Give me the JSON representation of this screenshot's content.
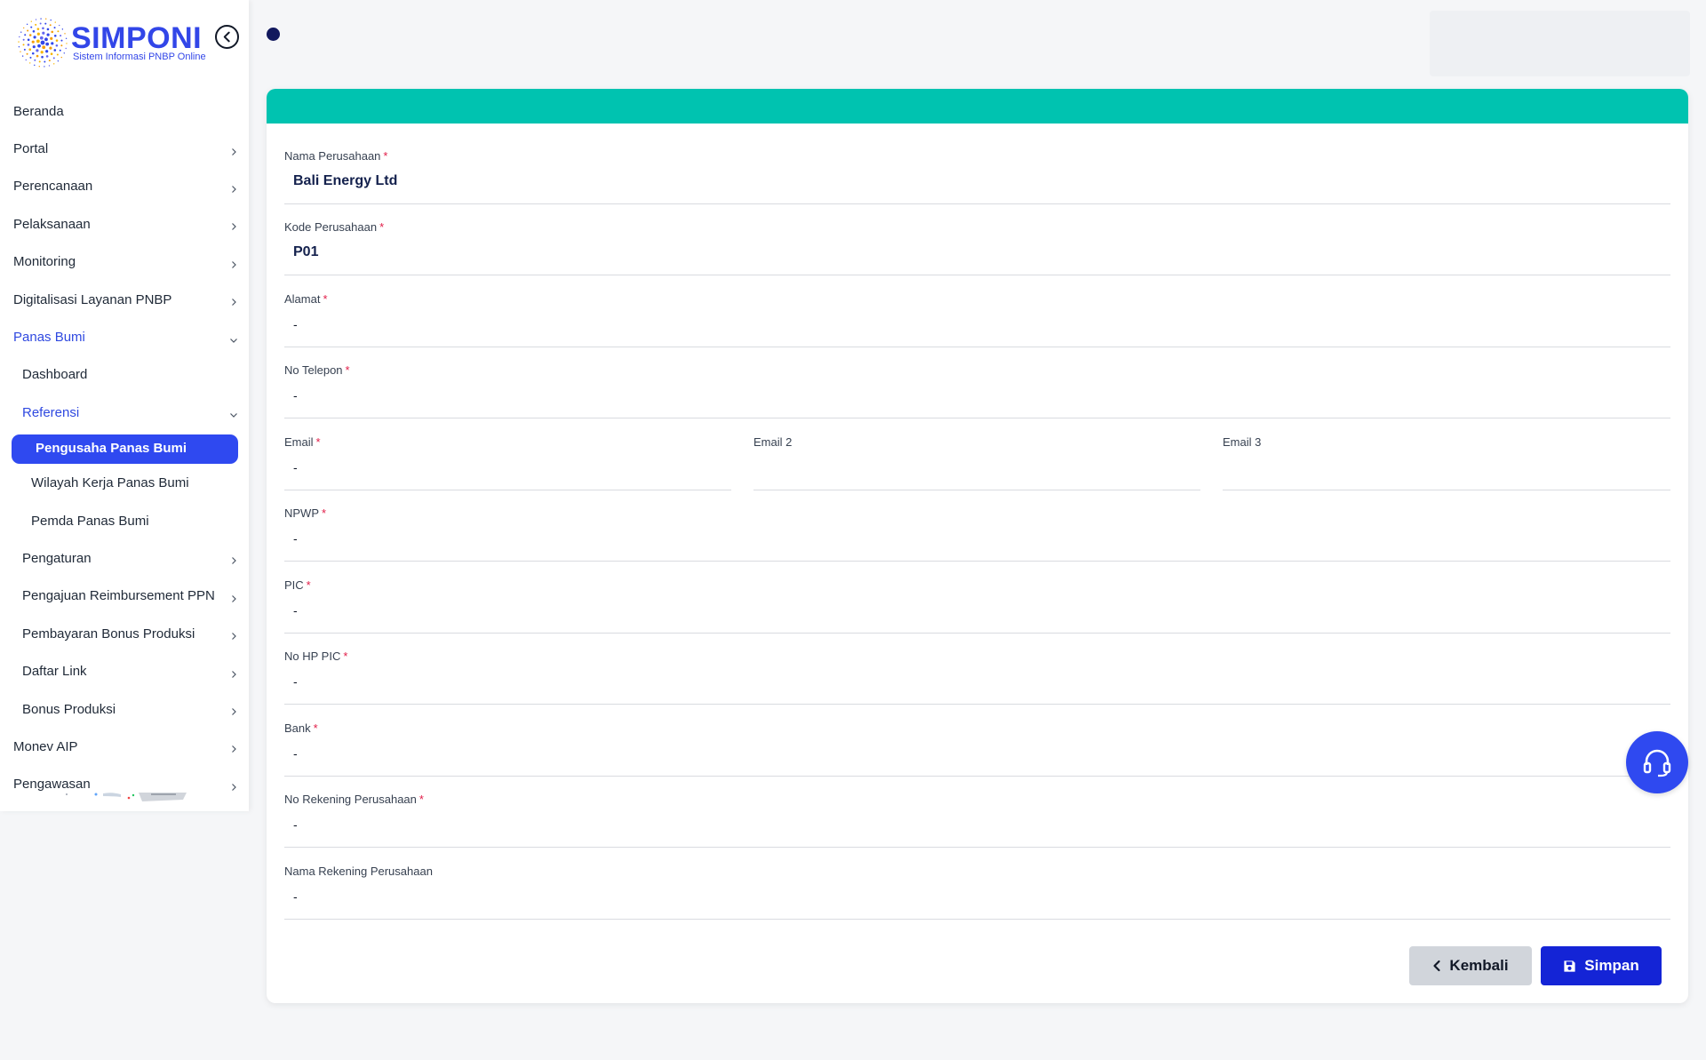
{
  "brand": {
    "title": "SIMPONI",
    "subtitle": "Sistem Informasi PNBP Online"
  },
  "sidebar": {
    "items": [
      {
        "label": "Beranda",
        "has_chevron": false,
        "state": "normal"
      },
      {
        "label": "Portal",
        "has_chevron": true,
        "chevron": "right",
        "state": "normal"
      },
      {
        "label": "Perencanaan",
        "has_chevron": true,
        "chevron": "right",
        "state": "normal"
      },
      {
        "label": "Pelaksanaan",
        "has_chevron": true,
        "chevron": "right",
        "state": "normal"
      },
      {
        "label": "Monitoring",
        "has_chevron": true,
        "chevron": "right",
        "state": "normal"
      },
      {
        "label": "Digitalisasi Layanan PNBP",
        "has_chevron": true,
        "chevron": "right",
        "state": "normal"
      },
      {
        "label": "Panas Bumi",
        "has_chevron": true,
        "chevron": "down",
        "state": "expanded"
      },
      {
        "label": "Dashboard",
        "has_chevron": false,
        "state": "normal"
      },
      {
        "label": "Referensi",
        "has_chevron": true,
        "chevron": "down",
        "state": "expanded"
      },
      {
        "label": "Pengusaha Panas Bumi",
        "has_chevron": false,
        "state": "active"
      },
      {
        "label": "Wilayah Kerja Panas Bumi",
        "has_chevron": false,
        "state": "normal"
      },
      {
        "label": "Pemda Panas Bumi",
        "has_chevron": false,
        "state": "normal"
      },
      {
        "label": "Pengaturan",
        "has_chevron": true,
        "chevron": "right",
        "state": "normal"
      },
      {
        "label": "Pengajuan Reimbursement PPN",
        "has_chevron": true,
        "chevron": "right",
        "state": "normal"
      },
      {
        "label": "Pembayaran Bonus Produksi",
        "has_chevron": true,
        "chevron": "right",
        "state": "normal"
      },
      {
        "label": "Daftar Link",
        "has_chevron": true,
        "chevron": "right",
        "state": "normal"
      },
      {
        "label": "Bonus Produksi",
        "has_chevron": true,
        "chevron": "right",
        "state": "normal"
      },
      {
        "label": "Monev AIP",
        "has_chevron": true,
        "chevron": "right",
        "state": "normal"
      },
      {
        "label": "Pengawasan",
        "has_chevron": true,
        "chevron": "right",
        "state": "normal"
      }
    ]
  },
  "form": {
    "header_color": "#00c3b0",
    "fields": {
      "nama_perusahaan": {
        "label": "Nama Perusahaan",
        "required": "*",
        "value": "Bali Energy Ltd"
      },
      "kode_perusahaan": {
        "label": "Kode Perusahaan",
        "required": "*",
        "value": "P01"
      },
      "alamat": {
        "label": "Alamat",
        "required": "*",
        "value": "-"
      },
      "no_telepon": {
        "label": "No Telepon",
        "required": "*",
        "value": "-"
      },
      "email": {
        "label": "Email",
        "required": "*",
        "value": "-"
      },
      "email2": {
        "label": "Email 2",
        "value": ""
      },
      "email3": {
        "label": "Email 3",
        "value": ""
      },
      "npwp": {
        "label": "NPWP",
        "required": "*",
        "value": "-"
      },
      "pic": {
        "label": "PIC",
        "required": "*",
        "value": "-"
      },
      "no_hp_pic": {
        "label": "No HP PIC",
        "required": "*",
        "value": "-"
      },
      "bank": {
        "label": "Bank",
        "required": "*",
        "value": "-"
      },
      "no_rekening": {
        "label": "No Rekening Perusahaan",
        "required": "*",
        "value": "-"
      },
      "nama_rekening": {
        "label": "Nama Rekening Perusahaan",
        "value": "-"
      }
    },
    "buttons": {
      "back_label": "Kembali",
      "save_label": "Simpan"
    }
  },
  "colors": {
    "brand_blue": "#3246e8",
    "active_pill": "#2f49f0",
    "save_button": "#1424d6",
    "back_button": "#d1d5db",
    "required_asterisk": "#e11d48"
  },
  "icons": {
    "collapse": "chevron-left-circle-icon",
    "help": "headset-icon",
    "save": "floppy-disk-icon",
    "back": "chevron-left-icon"
  }
}
